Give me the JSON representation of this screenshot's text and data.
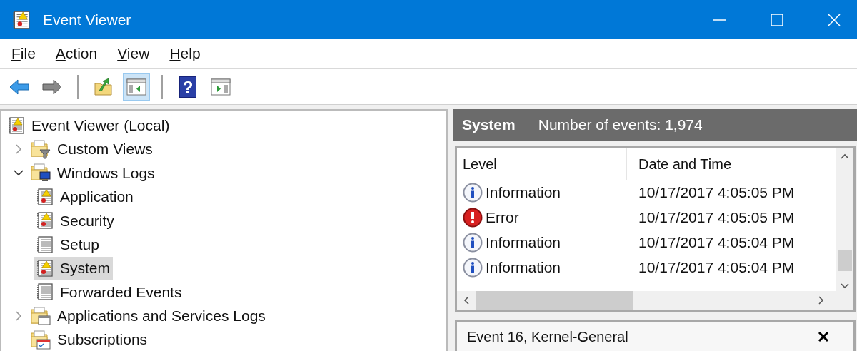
{
  "window": {
    "title": "Event Viewer"
  },
  "menu": [
    "File",
    "Action",
    "View",
    "Help"
  ],
  "toolbar": [
    {
      "kind": "back",
      "disabled": false,
      "selected": false
    },
    {
      "kind": "forward",
      "disabled": true,
      "selected": false
    },
    {
      "kind": "separator"
    },
    {
      "kind": "folder-up",
      "selected": false
    },
    {
      "kind": "tree-toggle",
      "disabled": false,
      "selected": true
    },
    {
      "kind": "separator"
    },
    {
      "kind": "help",
      "glyph": "?",
      "selected": false
    },
    {
      "kind": "action-toggle",
      "selected": false
    }
  ],
  "tree": [
    {
      "label": "Event Viewer (Local)",
      "kind": "viewer",
      "selected": false,
      "children": [
        {
          "label": "Custom Views",
          "kind": "folder-filter",
          "expanded": false,
          "selected": false
        },
        {
          "label": "Windows Logs",
          "kind": "folder-computer",
          "expanded": true,
          "selected": false,
          "children": [
            {
              "label": "Application",
              "kind": "log-alert",
              "selected": false
            },
            {
              "label": "Security",
              "kind": "log-alert",
              "selected": false
            },
            {
              "label": "Setup",
              "kind": "log-plain",
              "selected": false
            },
            {
              "label": "System",
              "kind": "log-alert",
              "selected": true
            },
            {
              "label": "Forwarded Events",
              "kind": "log-plain",
              "selected": false
            }
          ]
        },
        {
          "label": "Applications and Services Logs",
          "kind": "folder-window",
          "expanded": false,
          "selected": false
        },
        {
          "label": "Subscriptions",
          "kind": "folder-calendar",
          "selected": false
        }
      ]
    }
  ],
  "log_header": {
    "name": "System",
    "count": "Number of events: 1,974"
  },
  "table": {
    "columns": [
      "Level",
      "Date and Time"
    ],
    "rows": [
      {
        "kind": "information",
        "level": "Information",
        "date": "10/17/2017 4:05:05 PM"
      },
      {
        "kind": "error",
        "level": "Error",
        "date": "10/17/2017 4:05:05 PM"
      },
      {
        "kind": "information",
        "level": "Information",
        "date": "10/17/2017 4:05:04 PM"
      },
      {
        "kind": "information",
        "level": "Information",
        "date": "10/17/2017 4:05:04 PM"
      }
    ]
  },
  "detail": {
    "title": "Event 16, Kernel-General"
  }
}
